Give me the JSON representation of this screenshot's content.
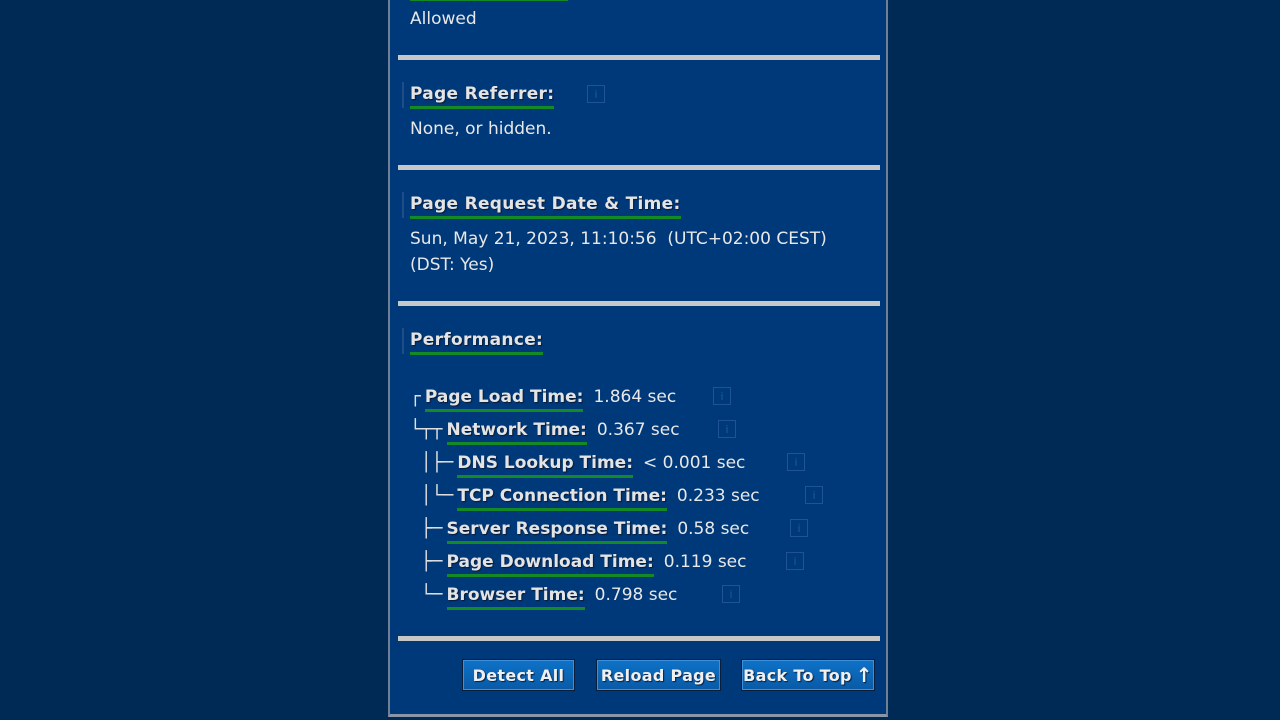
{
  "sections": {
    "previous": {
      "value": "Allowed"
    },
    "referrer": {
      "label": "Page Referrer:",
      "value": "None, or hidden.",
      "info": "i"
    },
    "request_time": {
      "label": "Page Request Date & Time:",
      "value_line1": "Sun, May 21, 2023, 11:10:56  (UTC+02:00 CEST)",
      "value_line2": "(DST: Yes)"
    },
    "performance": {
      "label": "Performance:",
      "rows": [
        {
          "tree": "┌",
          "label": "Page Load Time:",
          "value": "1.864 sec",
          "info": "i"
        },
        {
          "tree": "└┬┬",
          "label": "Network Time:",
          "value": "0.367 sec",
          "info": "i"
        },
        {
          "tree": " │├─",
          "label": "DNS Lookup Time:",
          "value": "< 0.001 sec",
          "info": "i"
        },
        {
          "tree": " │└─",
          "label": "TCP Connection Time:",
          "value": "0.233 sec",
          "info": "i"
        },
        {
          "tree": " ├─",
          "label": "Server Response Time:",
          "value": "0.58 sec",
          "info": "i"
        },
        {
          "tree": " ├─",
          "label": "Page Download Time:",
          "value": "0.119 sec",
          "info": "i"
        },
        {
          "tree": " └─",
          "label": "Browser Time:",
          "value": "0.798 sec",
          "info": "i"
        }
      ]
    }
  },
  "buttons": {
    "detect_all": "Detect All",
    "reload_page": "Reload Page",
    "back_to_top": "Back To Top",
    "back_to_top_arrow": "↑"
  },
  "colors": {
    "background": "#002a56",
    "panel": "#00397a",
    "underline": "#138a26",
    "button": "#0a5aa6"
  }
}
